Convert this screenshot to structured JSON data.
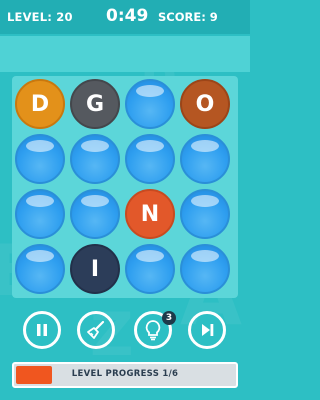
{
  "header": {
    "level": "LEVEL: 20",
    "time": "0:49",
    "score": "SCORE: 9"
  },
  "board": {
    "rows": [
      [
        {
          "letter": "D",
          "color": "orange"
        },
        {
          "letter": "G",
          "color": "grey"
        },
        {
          "letter": "",
          "color": "blue"
        },
        {
          "letter": "O",
          "color": "rust"
        }
      ],
      [
        {
          "letter": "",
          "color": "blue"
        },
        {
          "letter": "",
          "color": "blue"
        },
        {
          "letter": "",
          "color": "blue"
        },
        {
          "letter": "",
          "color": "blue"
        }
      ],
      [
        {
          "letter": "",
          "color": "blue"
        },
        {
          "letter": "",
          "color": "blue"
        },
        {
          "letter": "N",
          "color": "red"
        },
        {
          "letter": "",
          "color": "blue"
        }
      ],
      [
        {
          "letter": "",
          "color": "blue"
        },
        {
          "letter": "I",
          "color": "navy"
        },
        {
          "letter": "",
          "color": "blue"
        },
        {
          "letter": "",
          "color": "blue"
        }
      ]
    ]
  },
  "controls": {
    "pause": "pause-icon",
    "sweep": "broom-icon",
    "hint": "lightbulb-icon",
    "hint_count": "3",
    "skip": "skip-icon"
  },
  "progress": {
    "label": "LEVEL PROGRESS 1/6",
    "fraction": 0.167
  },
  "colors": {
    "background": "#2dbfc4",
    "bubble_blue": "#2f9ff0",
    "progress_fill": "#f0561f"
  }
}
